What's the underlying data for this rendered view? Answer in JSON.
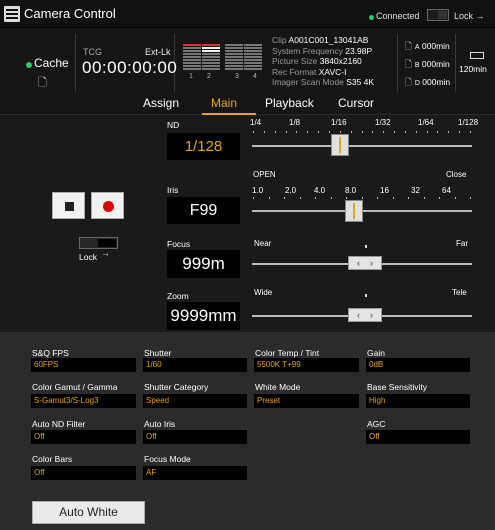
{
  "header": {
    "title": "Camera Control",
    "connection": "Connected",
    "lock_label": "Lock"
  },
  "status": {
    "cache_label": "Cache",
    "tcg_label": "TCG",
    "extlk_label": "Ext-Lk",
    "timecode": "00:00:00:00",
    "meter_channels": [
      "1",
      "2",
      "3",
      "4"
    ],
    "clip": [
      {
        "k": "Clip ",
        "v": "A001C001_13041AB"
      },
      {
        "k": "System Frequency ",
        "v": "23.98P"
      },
      {
        "k": "Picture Size ",
        "v": "3840x2160"
      },
      {
        "k": "Rec Format ",
        "v": "XAVC-I"
      },
      {
        "k": "Imager Scan Mode ",
        "v": "S35 4K"
      }
    ],
    "media": [
      {
        "slot": "A",
        "time": "000min"
      },
      {
        "slot": "B",
        "time": "000min"
      },
      {
        "slot": "D",
        "time": "000min"
      }
    ],
    "battery_time": "120min"
  },
  "tabs": [
    "Assign",
    "Main",
    "Playback",
    "Cursor"
  ],
  "active_tab": "Main",
  "controls": {
    "nd": {
      "label": "ND",
      "value": "1/128",
      "scale": [
        "1/4",
        "1/8",
        "1/16",
        "1/32",
        "1/64",
        "1/128"
      ]
    },
    "iris": {
      "label": "Iris",
      "value": "F99",
      "open_label": "OPEN",
      "close_label": "Close",
      "scale": [
        "1.0",
        "2.0",
        "4.0",
        "8.0",
        "16",
        "32",
        "64"
      ]
    },
    "focus": {
      "label": "Focus",
      "value": "999m",
      "near_label": "Near",
      "far_label": "Far"
    },
    "zoom": {
      "label": "Zoom",
      "value": "9999mm",
      "wide_label": "Wide",
      "tele_label": "Tele"
    },
    "lock_label": "Lock"
  },
  "settings": {
    "sq_fps": {
      "label": "S&Q FPS",
      "value": "60FPS"
    },
    "shutter": {
      "label": "Shutter",
      "value": "1/60"
    },
    "color_temp": {
      "label": "Color Temp / Tint",
      "value": "5500K T+99"
    },
    "gain": {
      "label": "Gain",
      "value": "0dB"
    },
    "color_gamut": {
      "label": "Color Gamut / Gamma",
      "value": "S-Gamut3/S-Log3"
    },
    "shutter_category": {
      "label": "Shutter Category",
      "value": "Speed"
    },
    "white_mode": {
      "label": "White Mode",
      "value": "Preset"
    },
    "base_sensitivity": {
      "label": "Base Sensitivity",
      "value": "High"
    },
    "auto_nd": {
      "label": "Auto ND Filter",
      "value": "Off"
    },
    "auto_iris": {
      "label": "Auto Iris",
      "value": "Off"
    },
    "agc": {
      "label": "AGC",
      "value": "Off"
    },
    "color_bars": {
      "label": "Color Bars",
      "value": "Off"
    },
    "focus_mode": {
      "label": "Focus Mode",
      "value": "AF"
    }
  },
  "auto_white_label": "Auto White",
  "colors": {
    "accent": "#f0a216",
    "connected": "#22d45a",
    "record": "#e00000"
  }
}
